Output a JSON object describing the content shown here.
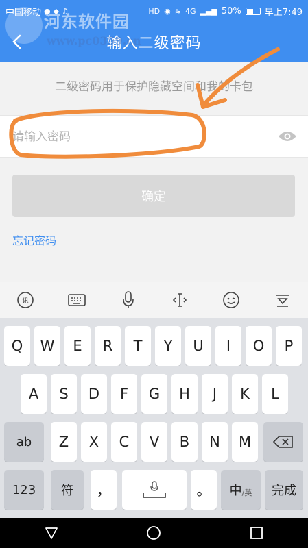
{
  "status_bar": {
    "carrier": "中国移动",
    "hd": "HD",
    "network": "4G",
    "battery": "50%",
    "battery_level": 0.5,
    "time": "早上7:49"
  },
  "title_bar": {
    "title": "输入二级密码"
  },
  "watermark": {
    "name": "河东软件园",
    "url": "www.pc0359.cn"
  },
  "hint": "二级密码用于保护隐藏空间和我的卡包",
  "password_input": {
    "placeholder": "请输入密码",
    "value": ""
  },
  "confirm_label": "确定",
  "forgot_label": "忘记密码",
  "keyboard": {
    "row1": [
      "Q",
      "W",
      "E",
      "R",
      "T",
      "Y",
      "U",
      "I",
      "O",
      "P"
    ],
    "row2": [
      "A",
      "S",
      "D",
      "F",
      "G",
      "H",
      "J",
      "K",
      "L"
    ],
    "row3_left": "ab",
    "row3": [
      "Z",
      "X",
      "C",
      "V",
      "B",
      "N",
      "M"
    ],
    "row4": {
      "num": "123",
      "sym": "符",
      "comma": "，",
      "period": "。",
      "lang": "中",
      "lang_sub": "/英",
      "done": "完成"
    }
  },
  "colors": {
    "accent": "#3f8ef0",
    "annotation": "#f08c3c"
  }
}
